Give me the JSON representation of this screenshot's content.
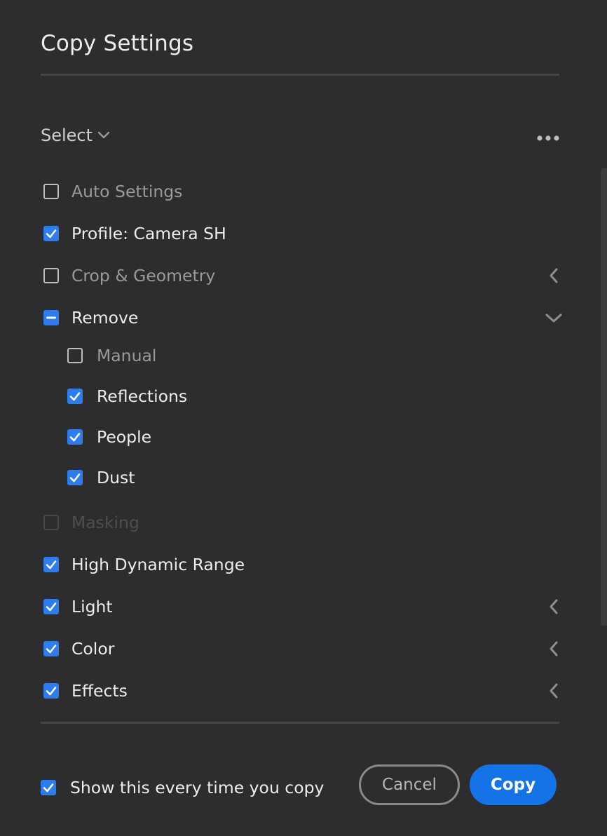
{
  "dialog": {
    "title": "Copy Settings",
    "select_label": "Select",
    "more_icon": "more-horizontal-icon"
  },
  "items": [
    {
      "label": "Auto Settings",
      "state": "unchecked",
      "chevron": "none"
    },
    {
      "label": "Profile: Camera SH",
      "state": "checked",
      "chevron": "none"
    },
    {
      "label": "Crop & Geometry",
      "state": "unchecked",
      "chevron": "collapsed"
    },
    {
      "label": "Remove",
      "state": "mixed",
      "chevron": "expanded"
    },
    {
      "label": "Manual",
      "state": "unchecked",
      "chevron": "none",
      "child": true
    },
    {
      "label": "Reflections",
      "state": "checked",
      "chevron": "none",
      "child": true
    },
    {
      "label": "People",
      "state": "checked",
      "chevron": "none",
      "child": true
    },
    {
      "label": "Dust",
      "state": "checked",
      "chevron": "none",
      "child": true
    },
    {
      "label": "Masking",
      "state": "disabled",
      "chevron": "none"
    },
    {
      "label": "High Dynamic Range",
      "state": "checked",
      "chevron": "none"
    },
    {
      "label": "Light",
      "state": "checked",
      "chevron": "collapsed"
    },
    {
      "label": "Color",
      "state": "checked",
      "chevron": "collapsed"
    },
    {
      "label": "Effects",
      "state": "checked",
      "chevron": "collapsed"
    }
  ],
  "footer": {
    "show_every_time_label": "Show this every time you copy",
    "show_every_time_checked": true,
    "cancel_label": "Cancel",
    "copy_label": "Copy"
  },
  "colors": {
    "background": "#2d2d2d",
    "accent": "#2b7df0",
    "primary_button": "#1473e6"
  }
}
